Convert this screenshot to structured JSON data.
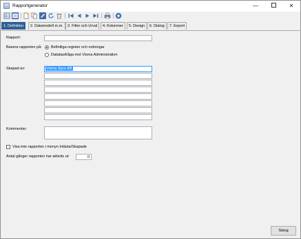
{
  "window": {
    "title": "Rapportgenerator",
    "minimize_glyph": "—",
    "close_glyph": "✕"
  },
  "toolbar": {
    "icons": [
      "table-view-icon",
      "form-view-icon",
      "new-icon",
      "copy-icon",
      "edit-icon",
      "refresh-icon",
      "delete-icon",
      "first-icon",
      "prev-icon",
      "next-icon",
      "last-icon",
      "print-icon",
      "help-icon"
    ]
  },
  "tabs": [
    {
      "label": "1. Definition",
      "active": true
    },
    {
      "label": "2. Datamodell m.m."
    },
    {
      "label": "3. Filter och Urval"
    },
    {
      "label": "4. Kolumner"
    },
    {
      "label": "5. Design"
    },
    {
      "label": "6. Dialog"
    },
    {
      "label": "7. Export"
    }
  ],
  "form": {
    "rapport_label": "Rapport:",
    "rapport_value": "",
    "basera_label": "Basera rapporten på:",
    "radio_1": "Befintliga register och ordningar",
    "radio_2": "Databasfråga mot Visma Administration",
    "skapad_label": "Skapad av:",
    "skapad_rows": [
      "Visma Spcs AB",
      "",
      "",
      "",
      "",
      "",
      "",
      ""
    ],
    "kommentar_label": "Kommentar:",
    "kommentar_value": "",
    "visa_inte_label": "Visa inte rapporten i menyn Inlästa/Skapade",
    "antal_label": "Antal gånger rapporten har aktivits ut:",
    "antal_value": "0",
    "close_button": "Stäng"
  },
  "colors": {
    "tab_active": "#2f5f95",
    "selection": "#3399ff"
  }
}
